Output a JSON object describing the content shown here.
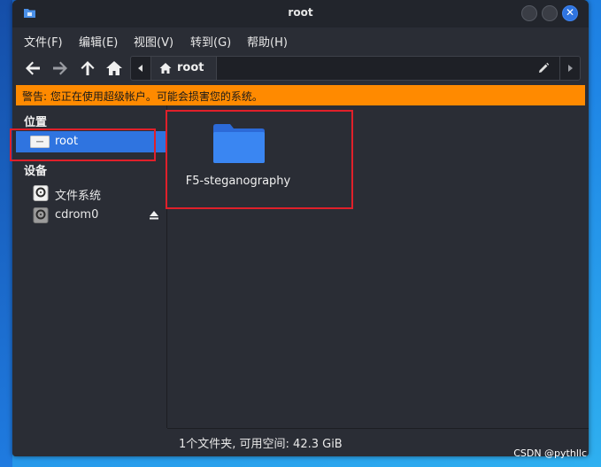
{
  "window": {
    "title": "root"
  },
  "menubar": {
    "items": [
      {
        "label": "文件(F)"
      },
      {
        "label": "编辑(E)"
      },
      {
        "label": "视图(V)"
      },
      {
        "label": "转到(G)"
      },
      {
        "label": "帮助(H)"
      }
    ]
  },
  "toolbar": {
    "icons": [
      "back-arrow-icon",
      "forward-arrow-icon",
      "up-arrow-icon",
      "home-icon"
    ],
    "path": {
      "crumb_label": "root",
      "icons": [
        "chevron-left-icon",
        "home-icon",
        "edit-pencil-icon",
        "chevron-right-icon"
      ]
    }
  },
  "warning": {
    "text": "警告: 您正在使用超级帐户。可能会损害您的系统。",
    "color": "#ff8a00"
  },
  "sidebar": {
    "places_heading": "位置",
    "places": [
      {
        "label": "root",
        "selected": true,
        "icon": "drive-icon"
      }
    ],
    "devices_heading": "设备",
    "devices": [
      {
        "label": "文件系统",
        "icon": "harddisk-icon"
      },
      {
        "label": "cdrom0",
        "icon": "optical-disc-icon",
        "ejectable": true
      }
    ]
  },
  "content": {
    "items": [
      {
        "name": "F5-steganography",
        "type": "folder",
        "icon": "folder-icon"
      }
    ]
  },
  "statusbar": {
    "text": "1个文件夹, 可用空间: 42.3 GiB"
  },
  "watermark": {
    "text": "CSDN @pythllc"
  },
  "colors": {
    "accent": "#2f74e0",
    "annotation": "#e0202a",
    "window_bg": "#2a2d35"
  }
}
